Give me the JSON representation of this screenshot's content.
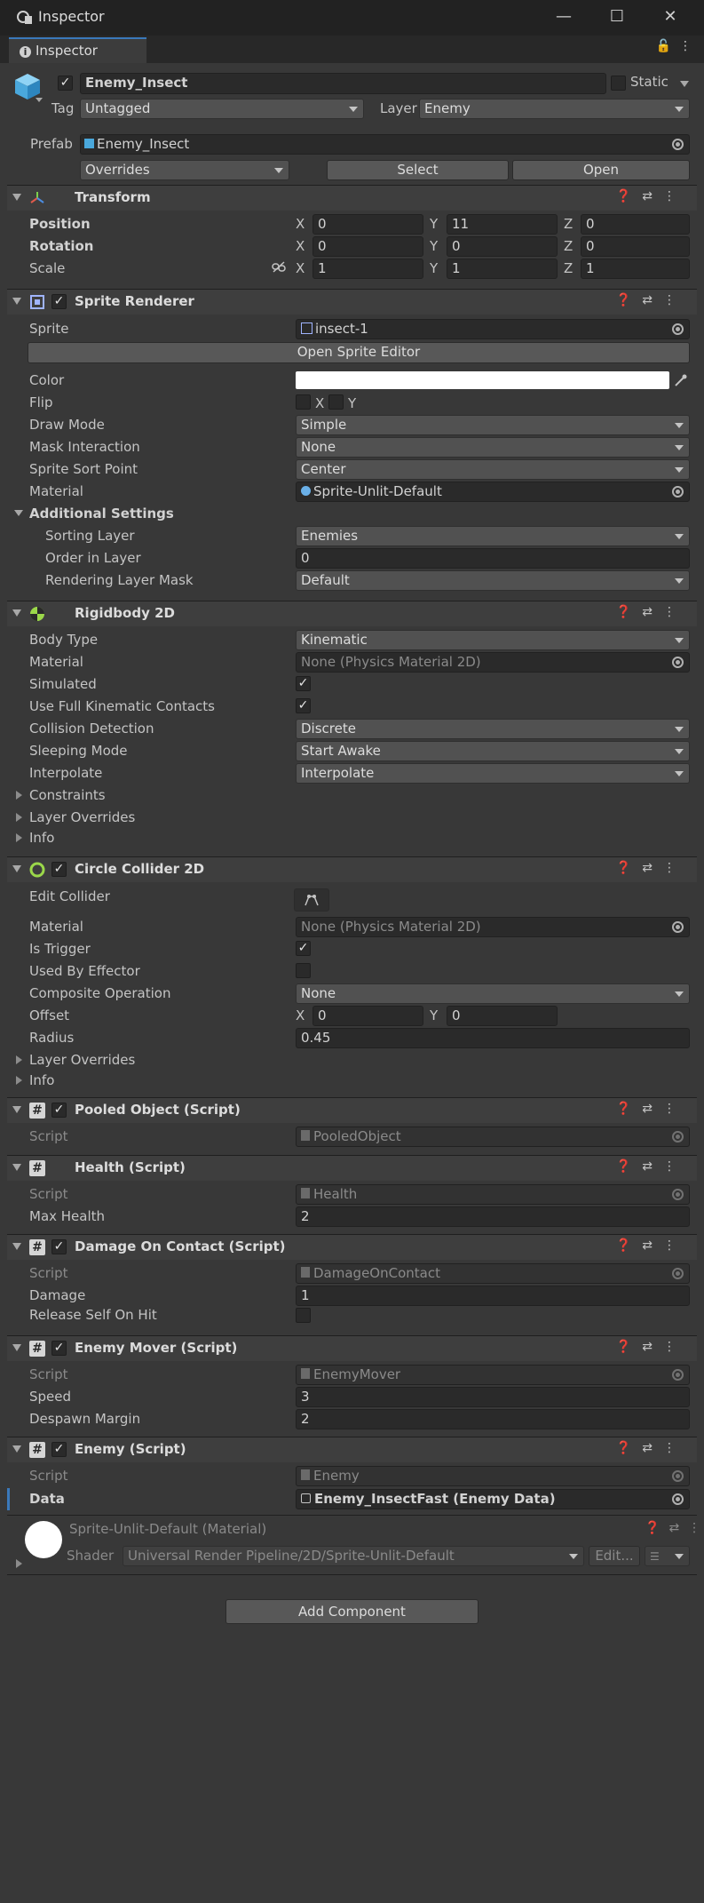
{
  "window": {
    "title": "Inspector",
    "tab": "Inspector",
    "min": "—",
    "max": "☐",
    "close": "✕"
  },
  "object": {
    "name": "Enemy_Insect",
    "static_label": "Static",
    "tag_label": "Tag",
    "tag": "Untagged",
    "layer_label": "Layer",
    "layer": "Enemy",
    "prefab_label": "Prefab",
    "prefab": "Enemy_Insect",
    "overrides": "Overrides",
    "select": "Select",
    "open": "Open"
  },
  "transform": {
    "title": "Transform",
    "position": "Position",
    "rotation": "Rotation",
    "scale": "Scale",
    "pos": [
      "0",
      "11",
      "0"
    ],
    "rot": [
      "0",
      "0",
      "0"
    ],
    "scl": [
      "1",
      "1",
      "1"
    ],
    "x": "X",
    "y": "Y",
    "z": "Z"
  },
  "sprite_renderer": {
    "title": "Sprite Renderer",
    "sprite_label": "Sprite",
    "sprite": "insect-1",
    "open_editor": "Open Sprite Editor",
    "color_label": "Color",
    "flip_label": "Flip",
    "flip_x": "X",
    "flip_y": "Y",
    "draw_mode_label": "Draw Mode",
    "draw_mode": "Simple",
    "mask_label": "Mask Interaction",
    "mask": "None",
    "sort_point_label": "Sprite Sort Point",
    "sort_point": "Center",
    "material_label": "Material",
    "material": "Sprite-Unlit-Default",
    "additional": "Additional Settings",
    "sorting_layer_label": "Sorting Layer",
    "sorting_layer": "Enemies",
    "order_label": "Order in Layer",
    "order": "0",
    "render_mask_label": "Rendering Layer Mask",
    "render_mask": "Default",
    "color_value": "#ffffff"
  },
  "rigidbody": {
    "title": "Rigidbody 2D",
    "body_type_label": "Body Type",
    "body_type": "Kinematic",
    "material_label": "Material",
    "material": "None (Physics Material 2D)",
    "simulated_label": "Simulated",
    "full_kin_label": "Use Full Kinematic Contacts",
    "collision_label": "Collision Detection",
    "collision": "Discrete",
    "sleeping_label": "Sleeping Mode",
    "sleeping": "Start Awake",
    "interpolate_label": "Interpolate",
    "interpolate": "Interpolate",
    "constraints": "Constraints",
    "layer_overrides": "Layer Overrides",
    "info": "Info"
  },
  "circle": {
    "title": "Circle Collider 2D",
    "edit_label": "Edit Collider",
    "material_label": "Material",
    "material": "None (Physics Material 2D)",
    "trigger_label": "Is Trigger",
    "effector_label": "Used By Effector",
    "composite_label": "Composite Operation",
    "composite": "None",
    "offset_label": "Offset",
    "offset_x": "0",
    "offset_y": "0",
    "radius_label": "Radius",
    "radius": "0.45",
    "layer_overrides": "Layer Overrides",
    "info": "Info"
  },
  "pooled": {
    "title": "Pooled Object (Script)",
    "script_label": "Script",
    "script": "PooledObject"
  },
  "health": {
    "title": "Health (Script)",
    "script_label": "Script",
    "script": "Health",
    "max_label": "Max Health",
    "max": "2"
  },
  "damage": {
    "title": "Damage On Contact (Script)",
    "script_label": "Script",
    "script": "DamageOnContact",
    "damage_label": "Damage",
    "damage": "1",
    "release_label": "Release Self On Hit"
  },
  "mover": {
    "title": "Enemy Mover (Script)",
    "script_label": "Script",
    "script": "EnemyMover",
    "speed_label": "Speed",
    "speed": "3",
    "despawn_label": "Despawn Margin",
    "despawn": "2"
  },
  "enemy": {
    "title": "Enemy (Script)",
    "script_label": "Script",
    "script": "Enemy",
    "data_label": "Data",
    "data": "Enemy_InsectFast (Enemy Data)"
  },
  "material_preview": {
    "name": "Sprite-Unlit-Default (Material)",
    "shader_label": "Shader",
    "shader": "Universal Render Pipeline/2D/Sprite-Unlit-Default",
    "edit": "Edit..."
  },
  "add_component": "Add Component"
}
